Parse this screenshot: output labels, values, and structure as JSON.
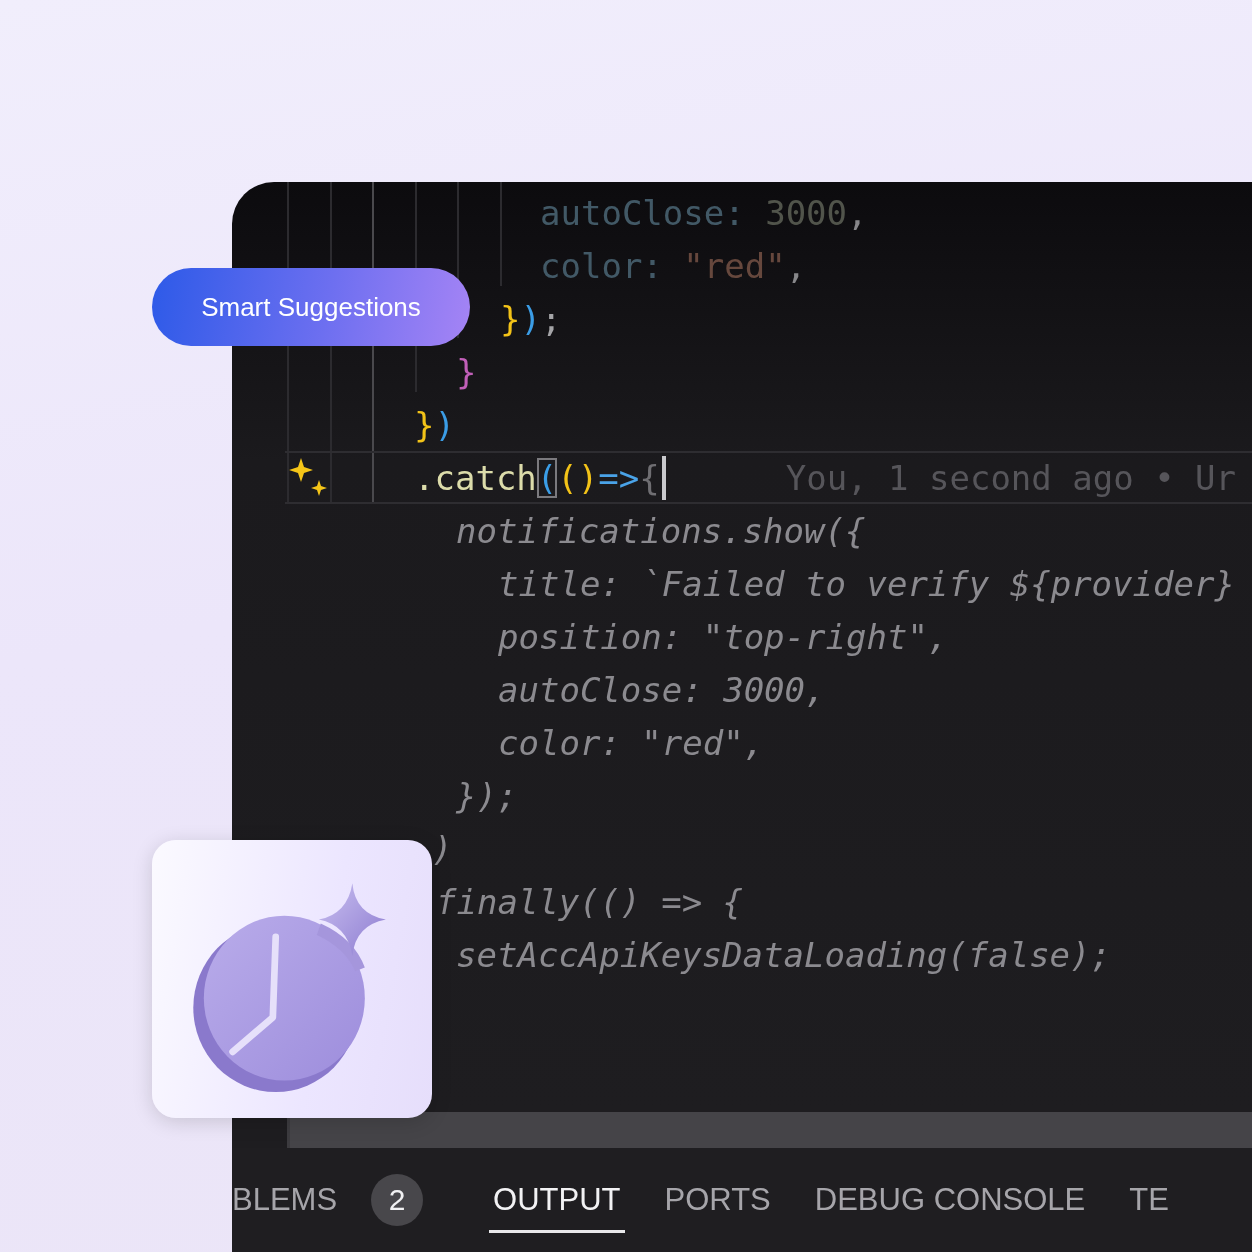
{
  "badge": {
    "label": "Smart Suggestions"
  },
  "editor": {
    "lines": [
      {
        "kind": "code",
        "tokens": [
          {
            "text": "autoClose:",
            "kind": "property"
          },
          {
            "text": " 3000",
            "kind": "number"
          },
          {
            "text": ",",
            "kind": "punct"
          }
        ]
      },
      {
        "kind": "code",
        "tokens": [
          {
            "text": "color:",
            "kind": "property"
          },
          {
            "text": " \"red\"",
            "kind": "string"
          },
          {
            "text": ",",
            "kind": "punct"
          }
        ]
      },
      {
        "kind": "code",
        "tokens": [
          {
            "text": "}",
            "kind": "brace-gold"
          },
          {
            "text": ")",
            "kind": "brace-blue"
          },
          {
            "text": ";",
            "kind": "punct"
          }
        ]
      },
      {
        "kind": "code",
        "tokens": [
          {
            "text": "}",
            "kind": "brace-pink"
          }
        ]
      },
      {
        "kind": "code",
        "tokens": [
          {
            "text": "}",
            "kind": "brace-gold"
          },
          {
            "text": ")",
            "kind": "brace-blue"
          }
        ]
      },
      {
        "kind": "current",
        "tokens": [
          {
            "text": ".catch",
            "kind": "method"
          },
          {
            "text": "(",
            "kind": "brace-blue"
          },
          {
            "text": "()",
            "kind": "brace-gold"
          },
          {
            "text": "=>",
            "kind": "arrow"
          },
          {
            "text": "{",
            "kind": "punct-dim"
          }
        ],
        "blame": "You, 1 second ago • Ur"
      },
      {
        "kind": "suggestion",
        "text": "notifications.show({"
      },
      {
        "kind": "suggestion",
        "text": "title: `Failed to verify ${provider}"
      },
      {
        "kind": "suggestion",
        "text": "position: \"top-right\","
      },
      {
        "kind": "suggestion",
        "text": "autoClose: 3000,"
      },
      {
        "kind": "suggestion",
        "text": "color: \"red\","
      },
      {
        "kind": "suggestion",
        "text": "});"
      },
      {
        "kind": "suggestion",
        "text": ")"
      },
      {
        "kind": "suggestion",
        "text": "finally(() => {"
      },
      {
        "kind": "suggestion",
        "text": "setAccApiKeysDataLoading(false);"
      }
    ]
  },
  "panel_tabs": [
    {
      "label": "BLEMS",
      "selected": false,
      "count": "2"
    },
    {
      "label": "OUTPUT",
      "selected": true
    },
    {
      "label": "PORTS",
      "selected": false
    },
    {
      "label": "DEBUG CONSOLE",
      "selected": false
    },
    {
      "label": "TE",
      "selected": false
    }
  ]
}
